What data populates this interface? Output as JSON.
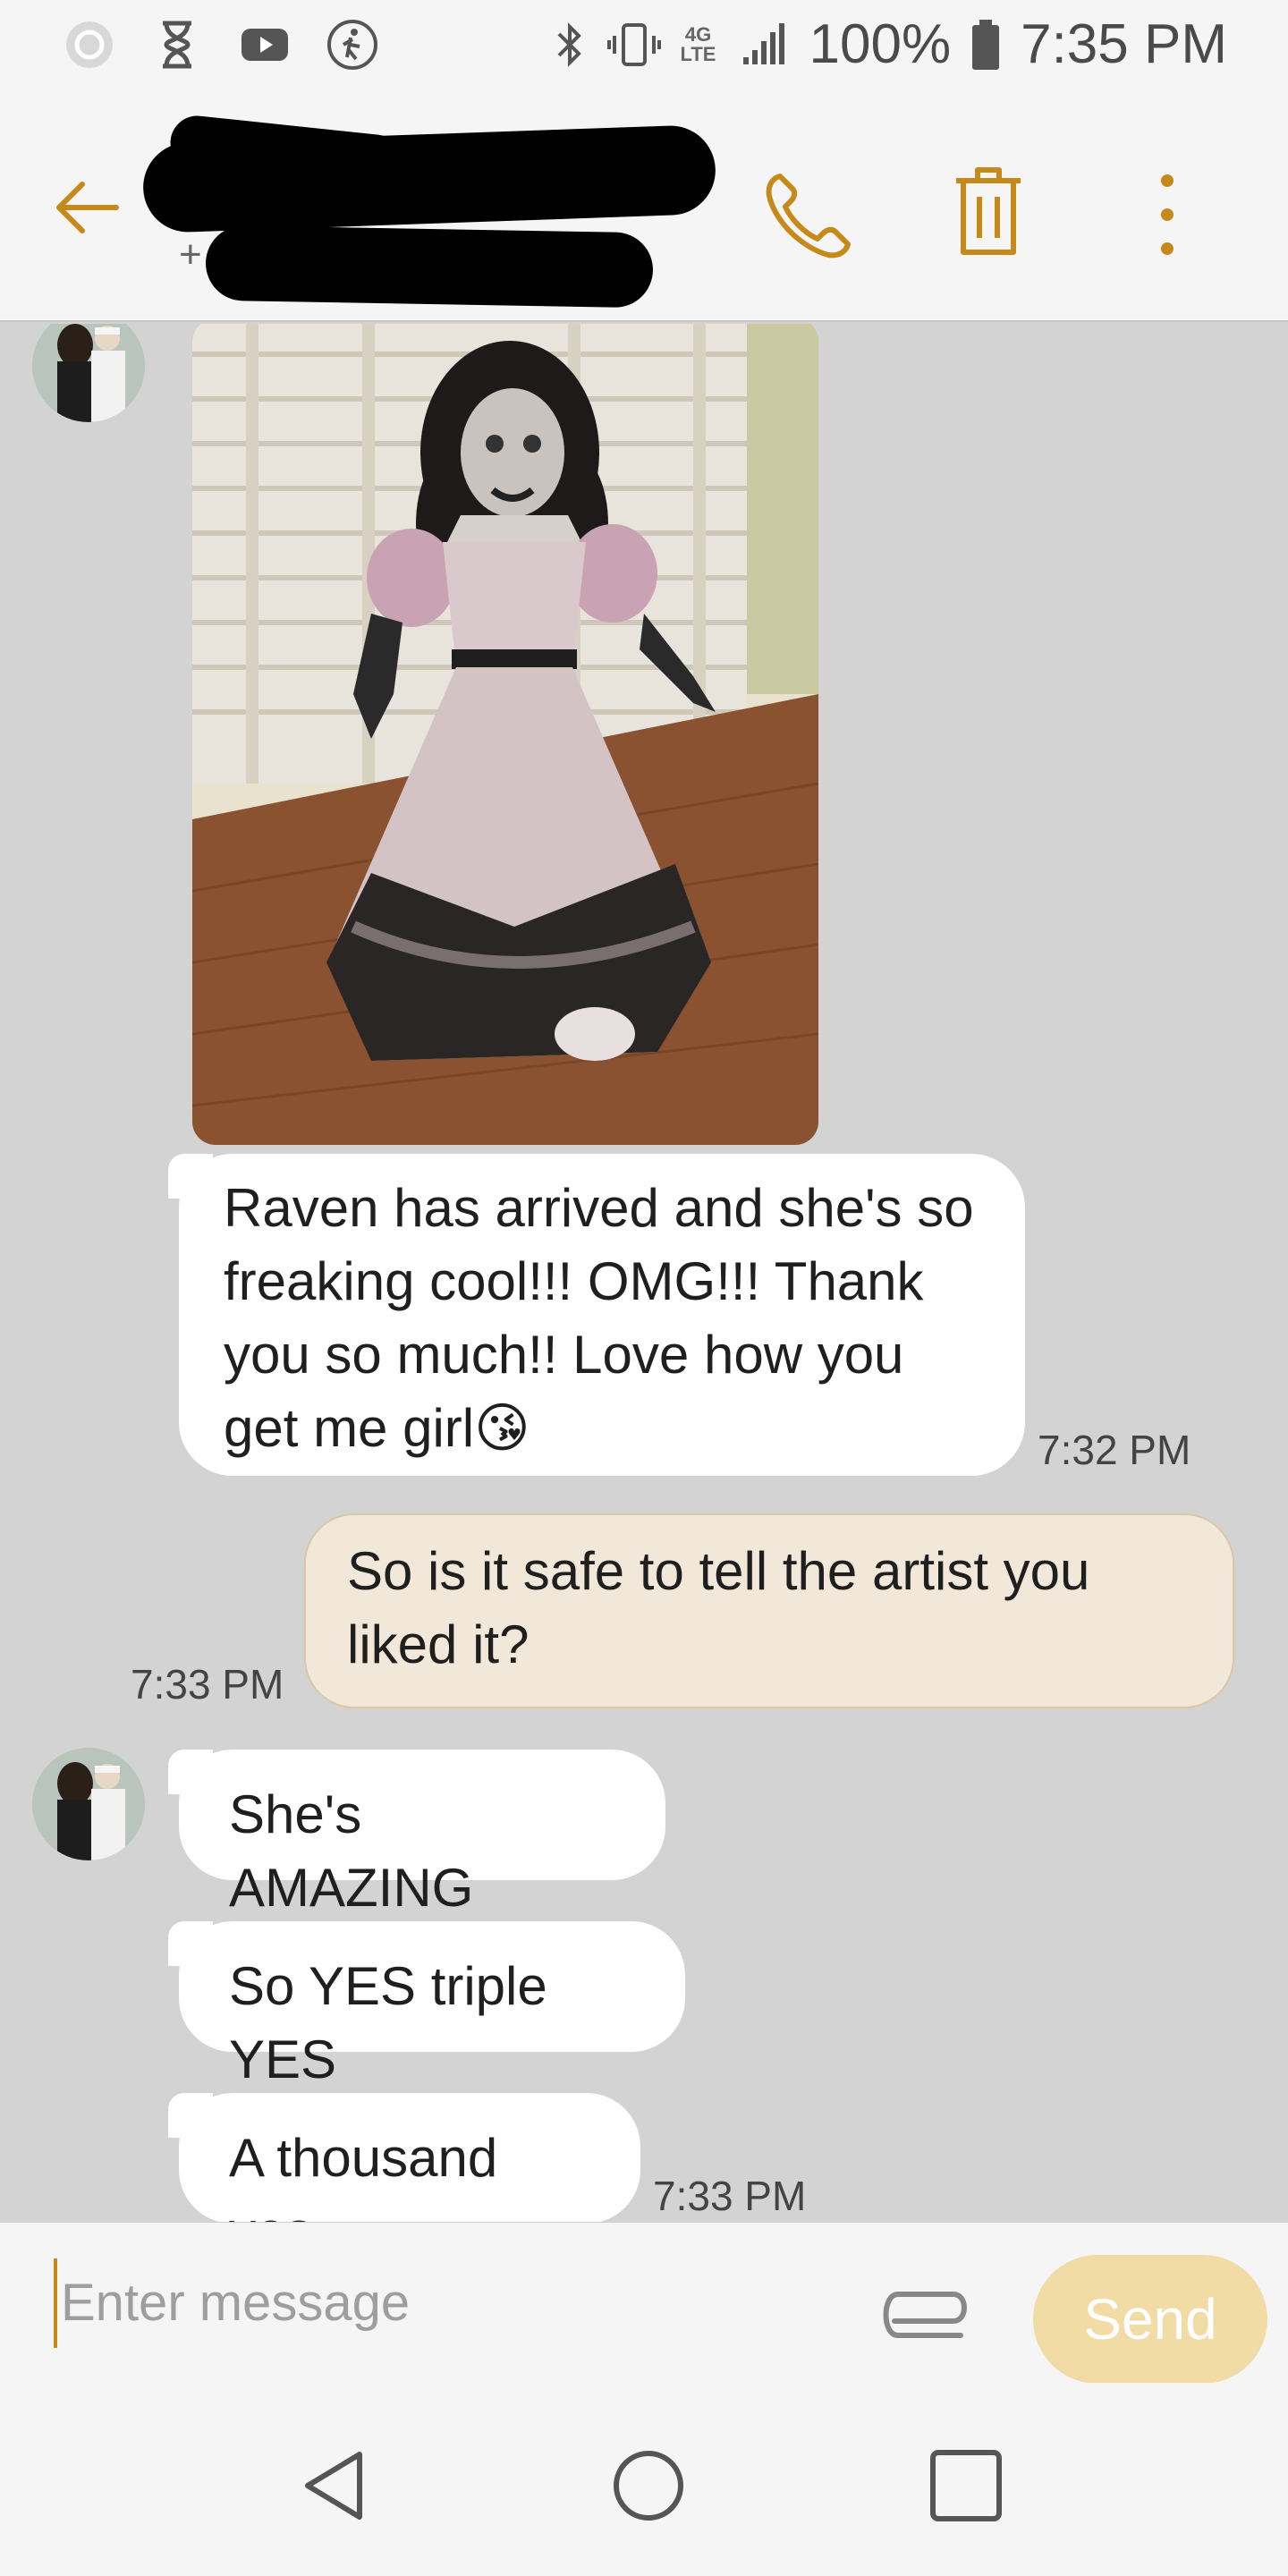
{
  "status_bar": {
    "network_type": "4G LTE",
    "battery": "100%",
    "time": "7:35 PM",
    "icons": [
      "app-icon",
      "hourglass-icon",
      "youtube-icon",
      "accessibility-icon",
      "bluetooth-icon",
      "vibrate-icon",
      "network-icon",
      "signal-icon",
      "battery-icon"
    ]
  },
  "header": {
    "contact_prefix": "+",
    "accent_color": "#c58a1a"
  },
  "messages": [
    {
      "type": "image",
      "direction": "in",
      "description_icon": "photo"
    },
    {
      "type": "text",
      "direction": "in",
      "lines": [
        "Raven has arrived and she's so",
        "freaking cool!!! OMG!!! Thank",
        "you so much!! Love how you",
        "get me girl"
      ],
      "emoji": "😘",
      "time": "7:32 PM"
    },
    {
      "type": "text",
      "direction": "out",
      "lines": [
        "So is it safe to tell the artist you",
        "liked it?"
      ],
      "time": "7:33 PM"
    },
    {
      "type": "text",
      "direction": "in",
      "lines": [
        "She's AMAZING"
      ]
    },
    {
      "type": "text",
      "direction": "in",
      "lines": [
        "So YES triple YES"
      ]
    },
    {
      "type": "text",
      "direction": "in",
      "lines": [
        "A thousand yes"
      ],
      "time": "7:33 PM"
    }
  ],
  "composer": {
    "placeholder": "Enter message",
    "send_label": "Send"
  },
  "colors": {
    "incoming_bubble": "#ffffff",
    "outgoing_bubble": "#f1e8d9",
    "send_button": "#f0dca4",
    "background": "#d3d3d3"
  }
}
